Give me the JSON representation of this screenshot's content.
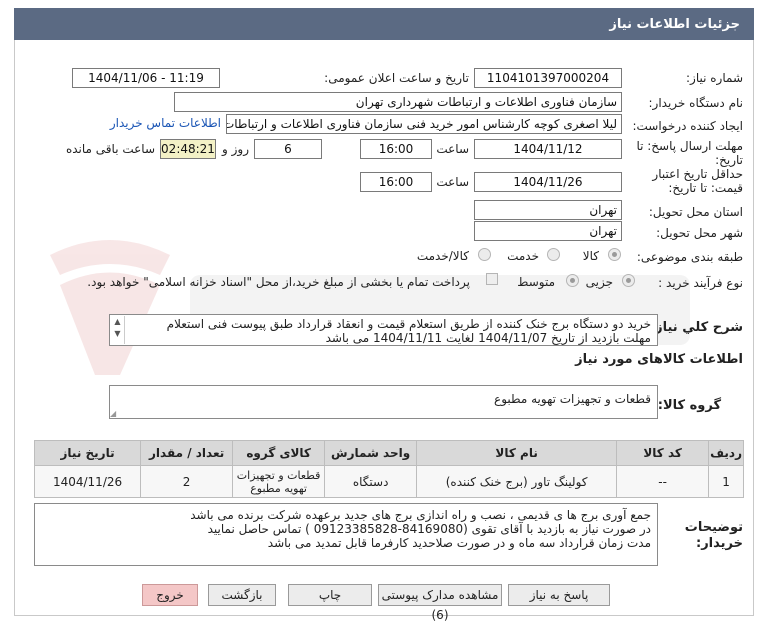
{
  "window": {
    "title": "جزئیات اطلاعات نیاز"
  },
  "form": {
    "need_number": {
      "label": "شماره نیاز:",
      "value": "1104101397000204"
    },
    "announce_datetime": {
      "label": "تاریخ و ساعت اعلان عمومی:",
      "value": "1404/11/06 - 11:19"
    },
    "buyer_org": {
      "label": "نام دستگاه خریدار:",
      "value": "سازمان فناوری اطلاعات و ارتباطات شهرداری تهران"
    },
    "creator": {
      "label": "ایجاد کننده درخواست:",
      "value": "لیلا اصغری کوچه کارشناس امور خرید فنی سازمان فناوری اطلاعات و ارتباطات ش",
      "contact_link": "اطلاعات تماس خریدار"
    },
    "reply_deadline": {
      "label1": "مهلت ارسال پاسخ: تا",
      "label2": "تاریخ:",
      "date": "1404/11/12",
      "time_label": "ساعت",
      "time": "16:00",
      "days": "6",
      "days_label": "روز و",
      "remaining": "02:48:21",
      "remaining_label": "ساعت باقی مانده"
    },
    "price_validity": {
      "label1": "حداقل تاریخ اعتبار",
      "label2": "قیمت: تا تاریخ:",
      "date": "1404/11/26",
      "time_label": "ساعت",
      "time": "16:00"
    },
    "delivery_province": {
      "label": "استان محل تحویل:",
      "value": "تهران"
    },
    "delivery_city": {
      "label": "شهر محل تحویل:",
      "value": "تهران"
    },
    "category": {
      "label": "طبقه بندی موضوعی:",
      "options": [
        "کالا",
        "خدمت",
        "کالا/خدمت"
      ],
      "selected": "کالا"
    },
    "process_type": {
      "label": "نوع فرآیند خرید :",
      "options": [
        "جزیی",
        "متوسط"
      ],
      "selected": "جزیی",
      "checkbox_text": "پرداخت تمام یا بخشی از مبلغ خرید،از محل \"اسناد خزانه اسلامی\" خواهد بود."
    },
    "description": {
      "label": "شرح کلي نياز:",
      "line1": "خرید دو دستگاه برج خنک کننده از طریق استعلام قیمت و انعقاد قرارداد طبق پیوست فنی استعلام",
      "line2": "مهلت بازدید از تاریخ 1404/11/07 لغایت 1404/11/11 می باشد"
    },
    "goods_info_title": "اطلاعات کالاهای مورد نیاز",
    "goods_group": {
      "label": "گروه کالا:",
      "value": "قطعات و تجهیزات تهویه مطبوع"
    }
  },
  "table": {
    "headers": [
      "ردیف",
      "کد کالا",
      "نام کالا",
      "واحد شمارش",
      "کالای گروه",
      "تعداد / مقدار",
      "تاریخ نیاز"
    ],
    "rows": [
      [
        "1",
        "--",
        "کولینگ تاور (برج خنک کننده)",
        "دستگاه",
        "قطعات و تجهیزات تهویه مطبوع",
        "2",
        "1404/11/26"
      ]
    ]
  },
  "buyer_notes": {
    "label1": "توضیحات",
    "label2": "خریدار:",
    "line1": "جمع آوری برج ها ی قدیمی ، نصب و راه اندازی برج های جدید  برعهده شرکت برنده می باشد",
    "line2": "در صورت نیاز به بازدید با آقای تقوی (84169080-09123385828 ) تماس حاصل نمایید",
    "line3": "مدت زمان قرارداد سه ماه و در صورت صلاحدید کارفرما قابل تمدید می باشد"
  },
  "buttons": {
    "reply": "پاسخ به نیاز",
    "view_docs": "مشاهده مدارک پیوستی (6)",
    "print": "چاپ",
    "back": "بازگشت",
    "exit": "خروج"
  },
  "colors": {
    "titlebar": "#5b6a83",
    "remaining_bg": "#f3f1c6",
    "link": "#1a55b5",
    "exit_bg": "#f4c7c7"
  }
}
